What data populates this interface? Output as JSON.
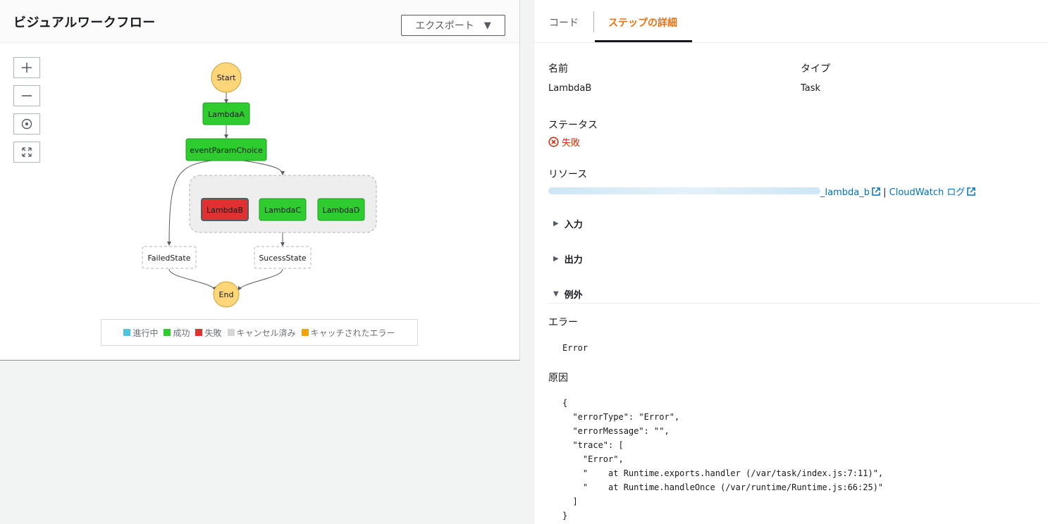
{
  "left": {
    "title": "ビジュアルワークフロー",
    "export_label": "エクスポート",
    "zoom_controls": [
      "zoom-in-icon",
      "zoom-out-icon",
      "center-icon",
      "fit-icon"
    ]
  },
  "workflow": {
    "nodes": {
      "start": "Start",
      "lambda_a": "LambdaA",
      "choice": "eventParamChoice",
      "lambda_b": "LambdaB",
      "lambda_c": "LambdaC",
      "lambda_d": "LambdaD",
      "failed": "FailedState",
      "success": "SucessState",
      "end": "End"
    },
    "colors": {
      "success": "#2ecc2e",
      "failed": "#e03030",
      "start_end": "#ffd677",
      "in_progress": "#4ec3e0",
      "cancelled": "#d5d5d5",
      "caught": "#f0a30a"
    }
  },
  "legend": [
    {
      "label": "進行中",
      "color": "#4ec3e0"
    },
    {
      "label": "成功",
      "color": "#2ecc2e"
    },
    {
      "label": "失敗",
      "color": "#e03030"
    },
    {
      "label": "キャンセル済み",
      "color": "#d5d5d5"
    },
    {
      "label": "キャッチされたエラー",
      "color": "#f0a30a"
    }
  ],
  "tabs": {
    "code": "コード",
    "details": "ステップの詳細"
  },
  "details": {
    "name_label": "名前",
    "name_value": "LambdaB",
    "type_label": "タイプ",
    "type_value": "Task",
    "status_label": "ステータス",
    "status_value": "失敗",
    "resource_label": "リソース",
    "resource_link": "_lambda_b",
    "resource_sep": "|",
    "cloudwatch_link": "CloudWatch ログ",
    "input_label": "入力",
    "output_label": "出力",
    "exception_label": "例外",
    "error_label": "エラー",
    "error_value": "Error",
    "cause_label": "原因",
    "cause_value": "{\n  \"errorType\": \"Error\",\n  \"errorMessage\": \"\",\n  \"trace\": [\n    \"Error\",\n    \"    at Runtime.exports.handler (/var/task/index.js:7:11)\",\n    \"    at Runtime.handleOnce (/var/runtime/Runtime.js:66:25)\"\n  ]\n}"
  }
}
